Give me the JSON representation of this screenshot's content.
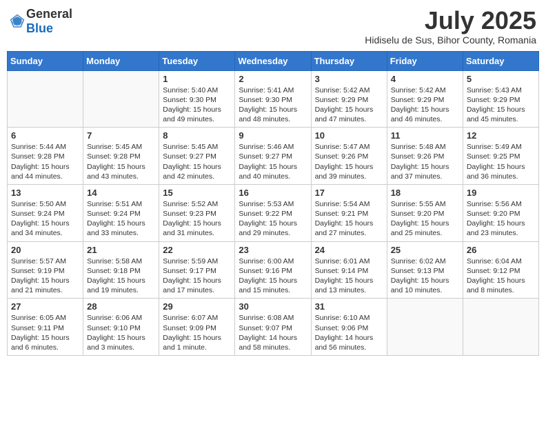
{
  "logo": {
    "general": "General",
    "blue": "Blue"
  },
  "title": {
    "month": "July 2025",
    "location": "Hidiselu de Sus, Bihor County, Romania"
  },
  "headers": [
    "Sunday",
    "Monday",
    "Tuesday",
    "Wednesday",
    "Thursday",
    "Friday",
    "Saturday"
  ],
  "weeks": [
    [
      {
        "day": "",
        "info": ""
      },
      {
        "day": "",
        "info": ""
      },
      {
        "day": "1",
        "info": "Sunrise: 5:40 AM\nSunset: 9:30 PM\nDaylight: 15 hours\nand 49 minutes."
      },
      {
        "day": "2",
        "info": "Sunrise: 5:41 AM\nSunset: 9:30 PM\nDaylight: 15 hours\nand 48 minutes."
      },
      {
        "day": "3",
        "info": "Sunrise: 5:42 AM\nSunset: 9:29 PM\nDaylight: 15 hours\nand 47 minutes."
      },
      {
        "day": "4",
        "info": "Sunrise: 5:42 AM\nSunset: 9:29 PM\nDaylight: 15 hours\nand 46 minutes."
      },
      {
        "day": "5",
        "info": "Sunrise: 5:43 AM\nSunset: 9:29 PM\nDaylight: 15 hours\nand 45 minutes."
      }
    ],
    [
      {
        "day": "6",
        "info": "Sunrise: 5:44 AM\nSunset: 9:28 PM\nDaylight: 15 hours\nand 44 minutes."
      },
      {
        "day": "7",
        "info": "Sunrise: 5:45 AM\nSunset: 9:28 PM\nDaylight: 15 hours\nand 43 minutes."
      },
      {
        "day": "8",
        "info": "Sunrise: 5:45 AM\nSunset: 9:27 PM\nDaylight: 15 hours\nand 42 minutes."
      },
      {
        "day": "9",
        "info": "Sunrise: 5:46 AM\nSunset: 9:27 PM\nDaylight: 15 hours\nand 40 minutes."
      },
      {
        "day": "10",
        "info": "Sunrise: 5:47 AM\nSunset: 9:26 PM\nDaylight: 15 hours\nand 39 minutes."
      },
      {
        "day": "11",
        "info": "Sunrise: 5:48 AM\nSunset: 9:26 PM\nDaylight: 15 hours\nand 37 minutes."
      },
      {
        "day": "12",
        "info": "Sunrise: 5:49 AM\nSunset: 9:25 PM\nDaylight: 15 hours\nand 36 minutes."
      }
    ],
    [
      {
        "day": "13",
        "info": "Sunrise: 5:50 AM\nSunset: 9:24 PM\nDaylight: 15 hours\nand 34 minutes."
      },
      {
        "day": "14",
        "info": "Sunrise: 5:51 AM\nSunset: 9:24 PM\nDaylight: 15 hours\nand 33 minutes."
      },
      {
        "day": "15",
        "info": "Sunrise: 5:52 AM\nSunset: 9:23 PM\nDaylight: 15 hours\nand 31 minutes."
      },
      {
        "day": "16",
        "info": "Sunrise: 5:53 AM\nSunset: 9:22 PM\nDaylight: 15 hours\nand 29 minutes."
      },
      {
        "day": "17",
        "info": "Sunrise: 5:54 AM\nSunset: 9:21 PM\nDaylight: 15 hours\nand 27 minutes."
      },
      {
        "day": "18",
        "info": "Sunrise: 5:55 AM\nSunset: 9:20 PM\nDaylight: 15 hours\nand 25 minutes."
      },
      {
        "day": "19",
        "info": "Sunrise: 5:56 AM\nSunset: 9:20 PM\nDaylight: 15 hours\nand 23 minutes."
      }
    ],
    [
      {
        "day": "20",
        "info": "Sunrise: 5:57 AM\nSunset: 9:19 PM\nDaylight: 15 hours\nand 21 minutes."
      },
      {
        "day": "21",
        "info": "Sunrise: 5:58 AM\nSunset: 9:18 PM\nDaylight: 15 hours\nand 19 minutes."
      },
      {
        "day": "22",
        "info": "Sunrise: 5:59 AM\nSunset: 9:17 PM\nDaylight: 15 hours\nand 17 minutes."
      },
      {
        "day": "23",
        "info": "Sunrise: 6:00 AM\nSunset: 9:16 PM\nDaylight: 15 hours\nand 15 minutes."
      },
      {
        "day": "24",
        "info": "Sunrise: 6:01 AM\nSunset: 9:14 PM\nDaylight: 15 hours\nand 13 minutes."
      },
      {
        "day": "25",
        "info": "Sunrise: 6:02 AM\nSunset: 9:13 PM\nDaylight: 15 hours\nand 10 minutes."
      },
      {
        "day": "26",
        "info": "Sunrise: 6:04 AM\nSunset: 9:12 PM\nDaylight: 15 hours\nand 8 minutes."
      }
    ],
    [
      {
        "day": "27",
        "info": "Sunrise: 6:05 AM\nSunset: 9:11 PM\nDaylight: 15 hours\nand 6 minutes."
      },
      {
        "day": "28",
        "info": "Sunrise: 6:06 AM\nSunset: 9:10 PM\nDaylight: 15 hours\nand 3 minutes."
      },
      {
        "day": "29",
        "info": "Sunrise: 6:07 AM\nSunset: 9:09 PM\nDaylight: 15 hours\nand 1 minute."
      },
      {
        "day": "30",
        "info": "Sunrise: 6:08 AM\nSunset: 9:07 PM\nDaylight: 14 hours\nand 58 minutes."
      },
      {
        "day": "31",
        "info": "Sunrise: 6:10 AM\nSunset: 9:06 PM\nDaylight: 14 hours\nand 56 minutes."
      },
      {
        "day": "",
        "info": ""
      },
      {
        "day": "",
        "info": ""
      }
    ]
  ]
}
